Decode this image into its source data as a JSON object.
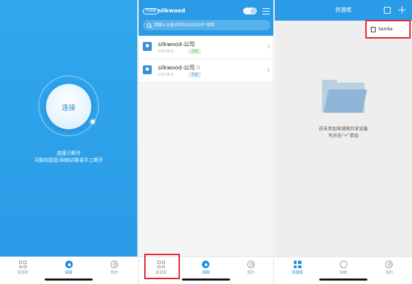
{
  "panel1": {
    "connect_label": "连接",
    "status_line1": "连接已断开",
    "status_line2": "可能的原因:网络切换或手工断开"
  },
  "panel2": {
    "badge": "开启端",
    "title": "silkwood",
    "search_placeholder": "请输入设备名称/UID/SID/IP 搜索",
    "devices": [
      {
        "name": "silkwood-公司",
        "ip": "172.16.0.",
        "tag": "在线",
        "extra": ""
      },
      {
        "name": "silkwood-公司",
        "ip": "172.16.3.",
        "tag": "在线",
        "extra": "回"
      }
    ]
  },
  "panel3": {
    "title": "资源库",
    "dropdown_item": "Samba",
    "empty_line1": "还未添加局域网共享设备",
    "empty_line2": "可点击\"+\"添加"
  },
  "nav": {
    "resource": "资源库",
    "network": "网络",
    "mine": "我的"
  },
  "icons": [
    "grid-icon",
    "network-icon",
    "person-icon",
    "menu-icon",
    "search-icon",
    "plus-icon",
    "device-icon",
    "folder-icon",
    "chevron-right-icon"
  ],
  "colors": {
    "primary": "#2a9be6",
    "highlight": "#e2232a",
    "online": "#3bb45a"
  }
}
